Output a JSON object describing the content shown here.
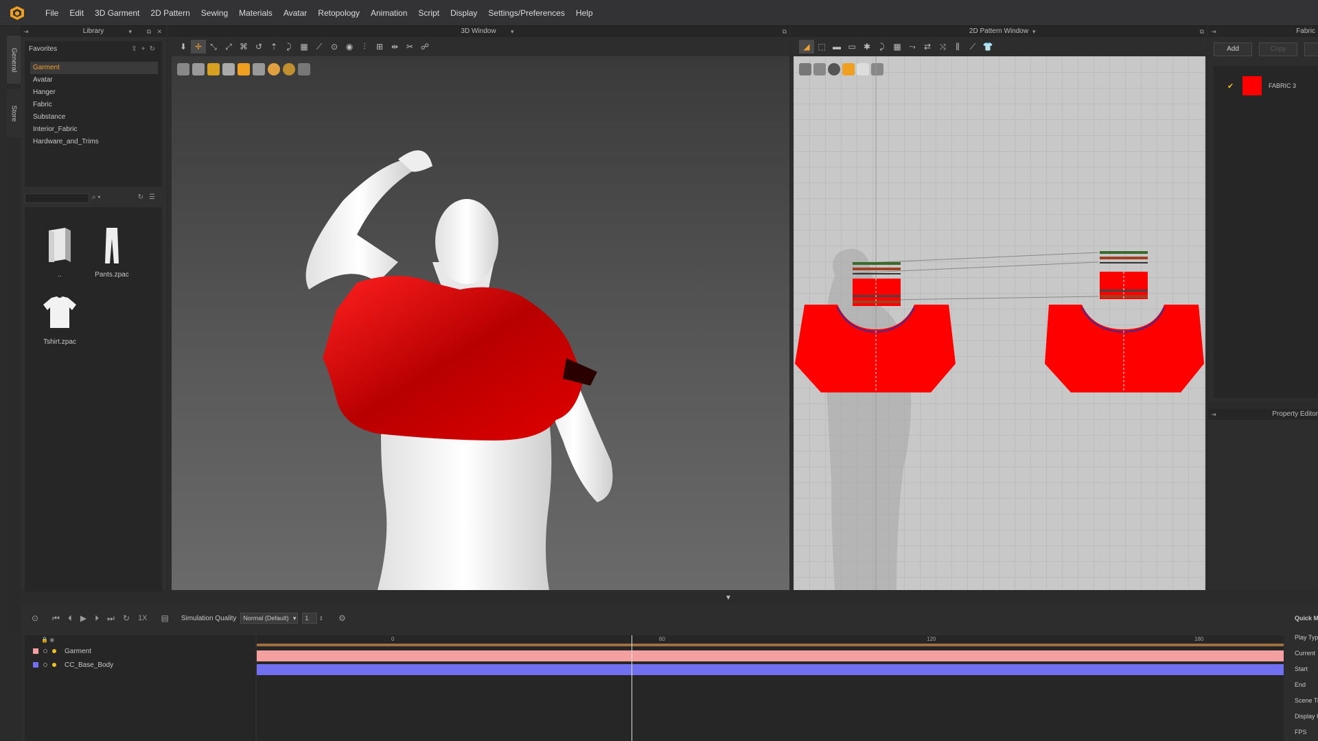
{
  "menu": [
    "File",
    "Edit",
    "3D Garment",
    "2D Pattern",
    "Sewing",
    "Materials",
    "Avatar",
    "Retopology",
    "Animation",
    "Script",
    "Display",
    "Settings/Preferences",
    "Help"
  ],
  "vtabs": {
    "general": "General",
    "store": "Store"
  },
  "library": {
    "title": "Library",
    "favorites_title": "Favorites",
    "favorites": [
      "Garment",
      "Avatar",
      "Hanger",
      "Fabric",
      "Substance",
      "Interior_Fabric",
      "Hardware_and_Trims"
    ],
    "active_favorite": "Garment",
    "files": [
      {
        "name": "..",
        "icon": "folder-icon"
      },
      {
        "name": "Pants.zpac",
        "icon": "pants-icon"
      },
      {
        "name": "Tshirt.zpac",
        "icon": "tshirt-icon"
      }
    ]
  },
  "window3d": {
    "title": "3D Window"
  },
  "window2d": {
    "title": "2D Pattern Window"
  },
  "fabric": {
    "title": "Fabric",
    "add_label": "Add",
    "copy_label": "Copy",
    "items": [
      {
        "name": "FABRIC 3",
        "color": "#ff0000",
        "checked": true
      }
    ]
  },
  "property_editor": {
    "title": "Property Editor"
  },
  "timeline": {
    "speed": "1X",
    "sim_quality_label": "Simulation Quality",
    "sim_quality_value": "Normal (Default)",
    "sim_steps": "1",
    "ticks": [
      "0",
      "60",
      "120",
      "180"
    ],
    "layers": [
      {
        "name": "Garment",
        "color": "#f4a0a0"
      },
      {
        "name": "CC_Base_Body",
        "color": "#7070f0"
      }
    ]
  },
  "quick_menu": {
    "title": "Quick Menu",
    "items": [
      "Play Type",
      "Current",
      "Start",
      "End",
      "Scene Time",
      "Display Unit",
      "FPS"
    ]
  },
  "colors": {
    "accent": "#f0a030",
    "garment_red": "#ff0000",
    "garment_track": "#f4a0a0",
    "body_track": "#7070f0"
  }
}
